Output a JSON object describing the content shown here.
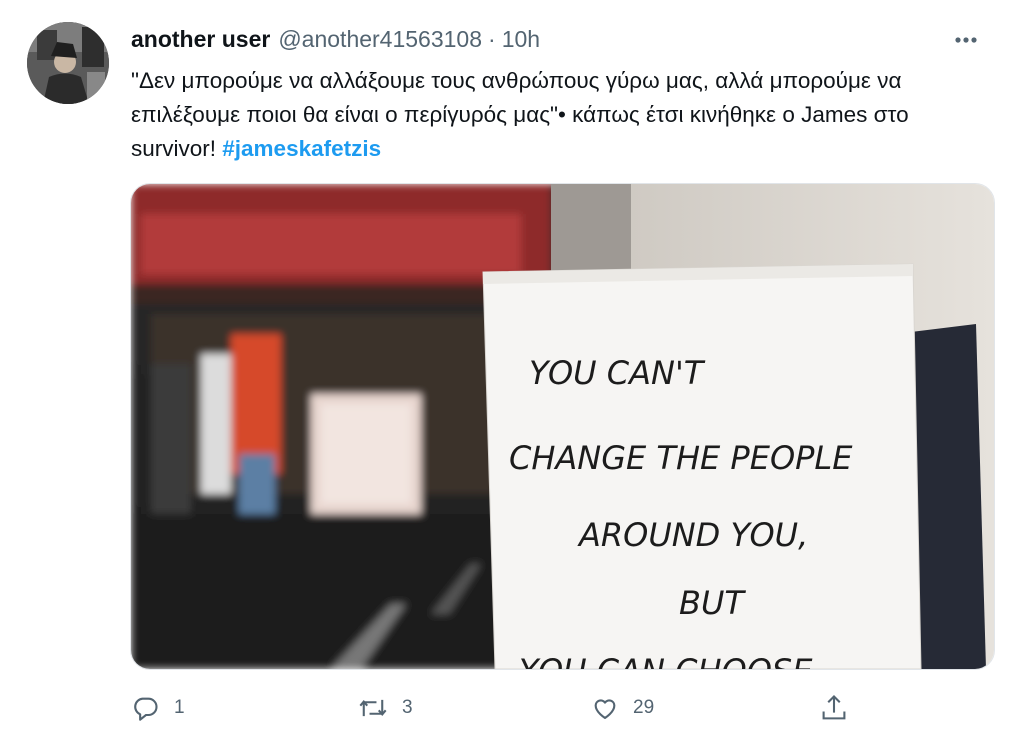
{
  "tweet": {
    "author_name": "another user",
    "author_handle": "@another41563108",
    "separator": "·",
    "time": "10h",
    "text_main": "\"Δεν μπορούμε να αλλάξουμε τους ανθρώπους γύρω μας, αλλά μπορούμε να επιλέξουμε ποιοι θα είναι ο περίγυρός μας\"• κάπως έτσι κινήθηκε ο James στο survivor! ",
    "hashtag": "#jameskafetzis"
  },
  "media": {
    "sign_text": [
      "YOU CAN'T",
      "CHANGE THE PEOPLE",
      "AROUND YOU,",
      "BUT",
      "YOU CAN CHOOSE"
    ]
  },
  "actions": {
    "reply_count": "1",
    "retweet_count": "3",
    "like_count": "29"
  },
  "colors": {
    "hashtag": "#1d9bf0",
    "secondary_text": "#536471",
    "primary_text": "#0f1419"
  },
  "icons": [
    "more-icon",
    "reply-icon",
    "retweet-icon",
    "like-icon",
    "share-icon"
  ]
}
